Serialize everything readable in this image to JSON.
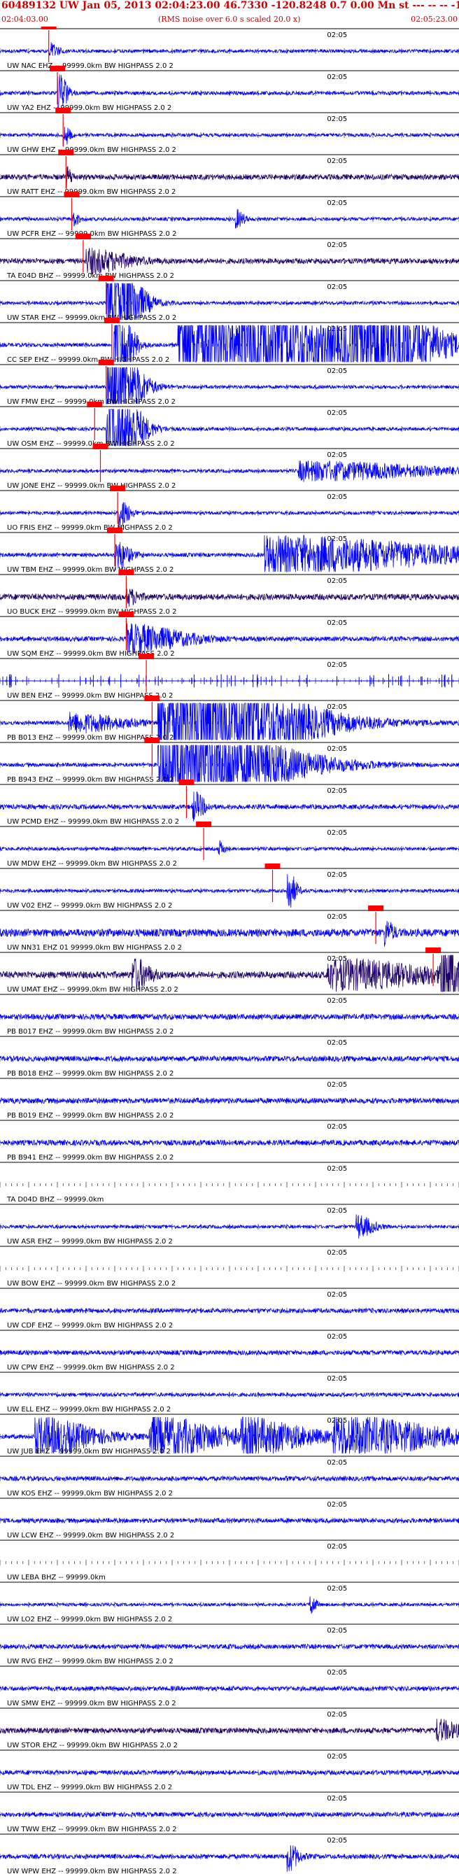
{
  "header": {
    "title": "60489132 UW Jan 05, 2013 02:04:23.00   46.7330 -120.8248  0.7 0.00 Mn st --- -- --   -1",
    "start_time": "02:04:03.00",
    "rms_note": "(RMS noise over 6.0 s scaled 20.0 x)",
    "end_time": "02:05:23.00"
  },
  "colors": {
    "trace": "#0000ff",
    "trace_dark": "#20006a",
    "pick": "#ff0000",
    "title": "#cc0000",
    "tick": "#000000"
  },
  "chart_data": {
    "type": "line",
    "title": "60489132 UW Jan 05, 2013 02:04:23.00   46.7330 -120.8248  0.7 0.00 Mn st --- -- --   -1",
    "x_range": [
      "02:04:03.00",
      "02:05:23.00"
    ],
    "x_tick_label": "02:05",
    "x_tick_time_s": 57,
    "x_span_s": 80,
    "grid": false,
    "traces": [
      {
        "label": "UW NAC EHZ -- 99999.0km BW  HIGHPASS  2.0  2",
        "pick_s": 8.5,
        "amp": 0.22,
        "events": [
          {
            "t": 8.5,
            "d": 1.6,
            "a": 1.0
          }
        ],
        "dark": false,
        "spikes": false
      },
      {
        "label": "UW YA2 EHZ -- 99999.0km BW  HIGHPASS  2.0  2",
        "pick_s": 10.0,
        "amp": 0.25,
        "events": [
          {
            "t": 10.0,
            "d": 1.5,
            "a": 3.0
          }
        ],
        "dark": false,
        "spikes": false
      },
      {
        "label": "UW GHW EHZ -- 99999.0km BW  HIGHPASS  2.0  2",
        "pick_s": 11.0,
        "amp": 0.22,
        "events": [
          {
            "t": 11.0,
            "d": 1.2,
            "a": 1.4
          }
        ],
        "dark": false,
        "spikes": false
      },
      {
        "label": "UW RATT EHZ -- 99999.0km BW  HIGHPASS  2.0  2",
        "pick_s": 11.5,
        "amp": 0.35,
        "events": [
          {
            "t": 11.5,
            "d": 1.0,
            "a": 1.3
          }
        ],
        "dark": true,
        "spikes": false
      },
      {
        "label": "UW PCFR EHZ -- 99999.0km BW  HIGHPASS  2.0  2",
        "pick_s": 12.5,
        "amp": 0.22,
        "events": [
          {
            "t": 12.5,
            "d": 1.2,
            "a": 1.0
          },
          {
            "t": 41.0,
            "d": 1.5,
            "a": 1.2
          }
        ],
        "dark": false,
        "spikes": false
      },
      {
        "label": "TA E04D BHZ -- 99999.0km BW  HIGHPASS  2.0  2",
        "pick_s": 14.5,
        "amp": 0.35,
        "events": [
          {
            "t": 15.0,
            "d": 7.0,
            "a": 1.5
          }
        ],
        "dark": true,
        "spikes": false
      },
      {
        "label": "UW STAR EHZ -- 99999.0km BW  HIGHPASS  2.0  2",
        "pick_s": 18.5,
        "amp": 0.22,
        "events": [
          {
            "t": 18.5,
            "d": 5.0,
            "a": 8.0
          }
        ],
        "dark": false,
        "spikes": false
      },
      {
        "label": "CC SEP EHZ -- 99999.0km BW  HIGHPASS  2.0  2",
        "pick_s": 19.5,
        "amp": 0.25,
        "events": [
          {
            "t": 19.5,
            "d": 3.0,
            "a": 8.0
          },
          {
            "t": 31.0,
            "d": 10.0,
            "a": 8.0
          },
          {
            "t": 42.0,
            "d": 18.0,
            "a": 6.0
          },
          {
            "t": 60.0,
            "d": 13.0,
            "a": 8.0
          }
        ],
        "dark": false,
        "spikes": false
      },
      {
        "label": "UW FMW EHZ -- 99999.0km BW  HIGHPASS  2.0  2",
        "pick_s": 18.5,
        "amp": 0.22,
        "events": [
          {
            "t": 18.5,
            "d": 5.0,
            "a": 8.0
          }
        ],
        "dark": false,
        "spikes": false
      },
      {
        "label": "UW OSM EHZ -- 99999.0km BW  HIGHPASS  2.0  2",
        "pick_s": 16.5,
        "amp": 0.22,
        "events": [
          {
            "t": 18.5,
            "d": 5.0,
            "a": 8.0
          }
        ],
        "dark": false,
        "spikes": false
      },
      {
        "label": "UW JONE EHZ -- 99999.0km BW  HIGHPASS  2.0  2",
        "pick_s": 17.5,
        "amp": 0.22,
        "events": [
          {
            "t": 52.0,
            "d": 24.0,
            "a": 1.2
          }
        ],
        "dark": false,
        "spikes": false
      },
      {
        "label": "UO FRIS EHZ -- 99999.0km BW  HIGHPASS  2.0  2",
        "pick_s": 20.5,
        "amp": 0.22,
        "events": [
          {
            "t": 20.5,
            "d": 2.0,
            "a": 2.0
          }
        ],
        "dark": false,
        "spikes": false
      },
      {
        "label": "UW TBM EHZ -- 99999.0km BW  HIGHPASS  2.0  2",
        "pick_s": 20.0,
        "amp": 0.25,
        "events": [
          {
            "t": 20.0,
            "d": 2.5,
            "a": 2.0
          },
          {
            "t": 46.0,
            "d": 32.0,
            "a": 2.5
          }
        ],
        "dark": false,
        "spikes": false
      },
      {
        "label": "UO BUCK EHZ -- 99999.0km BW  HIGHPASS  2.0  2",
        "pick_s": 22.0,
        "amp": 0.4,
        "events": [
          {
            "t": 22.0,
            "d": 2.0,
            "a": 1.0
          }
        ],
        "dark": true,
        "spikes": false
      },
      {
        "label": "UW SQM EHZ -- 99999.0km BW  HIGHPASS  2.0  2",
        "pick_s": 22.0,
        "amp": 0.3,
        "events": [
          {
            "t": 22.0,
            "d": 10.0,
            "a": 1.8
          }
        ],
        "dark": false,
        "spikes": false
      },
      {
        "label": "UW BEN EHZ -- 99999.0km BW  HIGHPASS  2.0  2",
        "pick_s": 25.5,
        "amp": 0.0,
        "events": [],
        "dark": false,
        "spikes": true
      },
      {
        "label": "PB B013 EHZ -- 99999.0km BW  HIGHPASS  2.0  2",
        "pick_s": 26.5,
        "amp": 0.25,
        "events": [
          {
            "t": 12.0,
            "d": 10.0,
            "a": 1.2
          },
          {
            "t": 27.5,
            "d": 22.0,
            "a": 8.0
          }
        ],
        "dark": false,
        "spikes": false
      },
      {
        "label": "PB B943 EHZ -- 99999.0km BW  HIGHPASS  2.0  2",
        "pick_s": 26.5,
        "amp": 0.25,
        "events": [
          {
            "t": 27.5,
            "d": 20.0,
            "a": 7.0
          }
        ],
        "dark": false,
        "spikes": false
      },
      {
        "label": "UW PCMD EHZ -- 99999.0km BW  HIGHPASS  2.0  2",
        "pick_s": 32.5,
        "amp": 0.3,
        "events": [
          {
            "t": 33.5,
            "d": 2.0,
            "a": 2.0
          }
        ],
        "dark": false,
        "spikes": false
      },
      {
        "label": "UW MDW EHZ -- 99999.0km BW  HIGHPASS  2.0  2",
        "pick_s": 35.5,
        "amp": 0.22,
        "events": [
          {
            "t": 38.0,
            "d": 1.0,
            "a": 1.0
          }
        ],
        "dark": false,
        "spikes": false
      },
      {
        "label": "UW V02 EHZ -- 99999.0km BW  HIGHPASS  2.0  2",
        "pick_s": 47.5,
        "amp": 0.22,
        "events": [
          {
            "t": 50.0,
            "d": 1.5,
            "a": 3.0
          }
        ],
        "dark": false,
        "spikes": false
      },
      {
        "label": "UW NN31 EHZ 01 99999.0km BW  HIGHPASS  2.0  2",
        "pick_s": 65.5,
        "amp": 0.5,
        "events": [
          {
            "t": 67.0,
            "d": 1.5,
            "a": 1.5
          }
        ],
        "dark": false,
        "spikes": false
      },
      {
        "label": "UW UMAT EHZ -- 99999.0km BW  HIGHPASS  2.0  2",
        "pick_s": 75.5,
        "amp": 0.45,
        "events": [
          {
            "t": 23.0,
            "d": 3.0,
            "a": 2.0
          },
          {
            "t": 57.0,
            "d": 19.0,
            "a": 1.8
          },
          {
            "t": 76.5,
            "d": 2.5,
            "a": 7.0
          }
        ],
        "dark": true,
        "spikes": false
      },
      {
        "label": "PB B017 EHZ -- 99999.0km BW  HIGHPASS  2.0  2",
        "pick_s": null,
        "amp": 0.35,
        "events": [],
        "dark": false,
        "spikes": false
      },
      {
        "label": "PB B018 EHZ -- 99999.0km BW  HIGHPASS  2.0  2",
        "pick_s": null,
        "amp": 0.35,
        "events": [],
        "dark": false,
        "spikes": false
      },
      {
        "label": "PB B019 EHZ -- 99999.0km BW  HIGHPASS  2.0  2",
        "pick_s": null,
        "amp": 0.35,
        "events": [],
        "dark": false,
        "spikes": false
      },
      {
        "label": "PB B941 EHZ -- 99999.0km BW  HIGHPASS  2.0  2",
        "pick_s": null,
        "amp": 0.35,
        "events": [],
        "dark": false,
        "spikes": false
      },
      {
        "label": "TA D04D BHZ -- 99999.0km",
        "pick_s": null,
        "amp": 0.0,
        "events": [],
        "dark": false,
        "spikes": false
      },
      {
        "label": "UW ASR EHZ -- 99999.0km BW  HIGHPASS  2.0  2",
        "pick_s": null,
        "amp": 0.22,
        "events": [
          {
            "t": 62.0,
            "d": 3.0,
            "a": 1.5
          }
        ],
        "dark": false,
        "spikes": false
      },
      {
        "label": "UW BOW EHZ -- 99999.0km BW  HIGHPASS  2.0  2",
        "pick_s": null,
        "amp": 0.0,
        "events": [],
        "dark": false,
        "spikes": false
      },
      {
        "label": "UW CDF EHZ -- 99999.0km BW  HIGHPASS  2.0  2",
        "pick_s": null,
        "amp": 0.3,
        "events": [],
        "dark": false,
        "spikes": false
      },
      {
        "label": "UW CPW EHZ -- 99999.0km BW  HIGHPASS  2.0  2",
        "pick_s": null,
        "amp": 0.3,
        "events": [],
        "dark": false,
        "spikes": false
      },
      {
        "label": "UW ELL EHZ -- 99999.0km BW  HIGHPASS  2.0  2",
        "pick_s": null,
        "amp": 0.25,
        "events": [],
        "dark": false,
        "spikes": false
      },
      {
        "label": "UW JUB EHZ -- 99999.0km BW  HIGHPASS  2.0  2",
        "pick_s": null,
        "amp": 0.3,
        "events": [
          {
            "t": 6.0,
            "d": 10.0,
            "a": 2.5
          },
          {
            "t": 26.0,
            "d": 14.0,
            "a": 2.5
          },
          {
            "t": 42.0,
            "d": 12.0,
            "a": 2.0
          },
          {
            "t": 58.0,
            "d": 20.0,
            "a": 2.5
          }
        ],
        "dark": false,
        "spikes": false
      },
      {
        "label": "UW KOS EHZ -- 99999.0km BW  HIGHPASS  2.0  2",
        "pick_s": null,
        "amp": 0.3,
        "events": [],
        "dark": false,
        "spikes": false
      },
      {
        "label": "UW LCW EHZ -- 99999.0km BW  HIGHPASS  2.0  2",
        "pick_s": null,
        "amp": 0.3,
        "events": [],
        "dark": false,
        "spikes": false
      },
      {
        "label": "UW LEBA BHZ -- 99999.0km",
        "pick_s": null,
        "amp": 0.0,
        "events": [],
        "dark": false,
        "spikes": false
      },
      {
        "label": "UW LO2 EHZ -- 99999.0km BW  HIGHPASS  2.0  2",
        "pick_s": null,
        "amp": 0.2,
        "events": [
          {
            "t": 54.0,
            "d": 1.0,
            "a": 1.5
          }
        ],
        "dark": false,
        "spikes": false
      },
      {
        "label": "UW RVG EHZ -- 99999.0km BW  HIGHPASS  2.0  2",
        "pick_s": null,
        "amp": 0.3,
        "events": [],
        "dark": false,
        "spikes": false
      },
      {
        "label": "UW SMW EHZ -- 99999.0km BW  HIGHPASS  2.0  2",
        "pick_s": null,
        "amp": 0.3,
        "events": [],
        "dark": false,
        "spikes": false
      },
      {
        "label": "UW STOR EHZ -- 99999.0km BW  HIGHPASS  2.0  2",
        "pick_s": null,
        "amp": 0.35,
        "events": [
          {
            "t": 76.0,
            "d": 4.0,
            "a": 1.3
          }
        ],
        "dark": true,
        "spikes": false
      },
      {
        "label": "UW TDL EHZ -- 99999.0km BW  HIGHPASS  2.0  2",
        "pick_s": null,
        "amp": 0.3,
        "events": [],
        "dark": false,
        "spikes": false
      },
      {
        "label": "UW TWW EHZ -- 99999.0km BW  HIGHPASS  2.0  2",
        "pick_s": null,
        "amp": 0.3,
        "events": [],
        "dark": false,
        "spikes": false
      },
      {
        "label": "UW WPW EHZ -- 99999.0km BW  HIGHPASS  2.0  2",
        "pick_s": null,
        "amp": 0.3,
        "events": [
          {
            "t": 50.0,
            "d": 2.0,
            "a": 1.8
          }
        ],
        "dark": false,
        "spikes": false
      }
    ]
  }
}
